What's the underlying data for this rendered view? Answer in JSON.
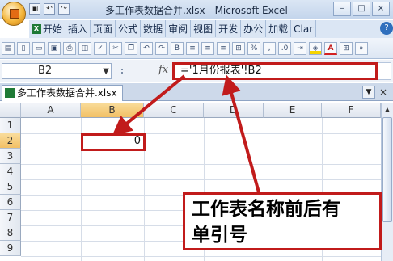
{
  "window": {
    "title": "多工作表数据合并.xlsx - Microsoft Excel",
    "buttons": [
      "–",
      "□",
      "×"
    ]
  },
  "ribbon_tabs": [
    "开始",
    "插入",
    "页面",
    "公式",
    "数据",
    "审阅",
    "视图",
    "开发",
    "办公",
    "加载",
    "Clar"
  ],
  "formula_bar": {
    "name_box": "B2",
    "fx": "fx",
    "formula": "='1月份报表'!B2"
  },
  "workbook_tab": "多工作表数据合并.xlsx *",
  "sheet": {
    "columns": [
      "A",
      "B",
      "C",
      "D",
      "E",
      "F"
    ],
    "rows": [
      "1",
      "2",
      "3",
      "4",
      "5",
      "6",
      "7",
      "8",
      "9"
    ],
    "selected_column": "B",
    "selected_row": "2",
    "cell_B2_value": "0"
  },
  "annotation": {
    "line1": "工作表名称前后有",
    "line2": "单引号"
  },
  "colors": {
    "annotation_red": "#c11b1b",
    "header_selected": "#f2c065"
  }
}
